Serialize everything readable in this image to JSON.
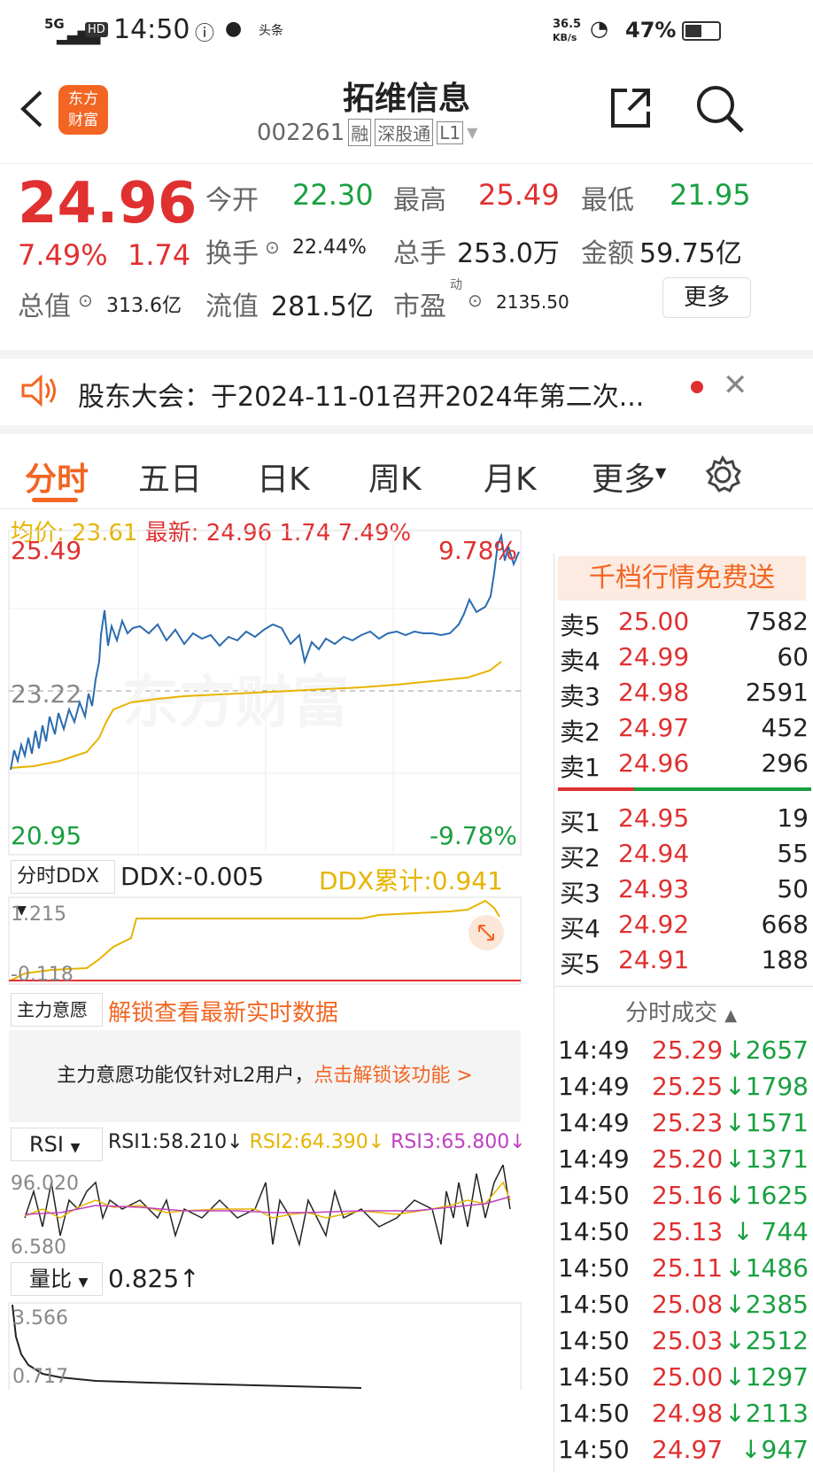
{
  "status": {
    "network": "5G",
    "time": "14:50",
    "speed": "36.5",
    "speed_unit": "KB/s",
    "battery": "47%",
    "app_badge": "头条"
  },
  "header": {
    "title": "拓维信息",
    "code": "002261",
    "badges": [
      "融",
      "深股通",
      "L1"
    ],
    "logo_line1": "东方",
    "logo_line2": "财富"
  },
  "quote": {
    "price": "24.96",
    "change_pct": "7.49%",
    "change": "1.74",
    "open_label": "今开",
    "open": "22.30",
    "high_label": "最高",
    "high": "25.49",
    "low_label": "最低",
    "low": "21.95",
    "turnover_label": "换手",
    "turnover": "22.44%",
    "volume_label": "总手",
    "volume": "253.0万",
    "amount_label": "金额",
    "amount": "59.75亿",
    "mktcap_label": "总值",
    "mktcap": "313.6亿",
    "float_label": "流值",
    "float": "281.5亿",
    "pe_label": "市盈",
    "pe_sup": "动",
    "pe": "2135.50",
    "more": "更多"
  },
  "notice": {
    "text": "股东大会：于2024-11-01召开2024年第二次..."
  },
  "tabs": [
    "分时",
    "五日",
    "日K",
    "周K",
    "月K",
    "更多"
  ],
  "avg": {
    "avg_label": "均价:",
    "avg": "23.61",
    "latest_label": "最新:",
    "latest": "24.96",
    "chg": "1.74",
    "pct": "7.49%"
  },
  "chart": {
    "ymax": "25.49",
    "ymid": "23.22",
    "ymin": "20.95",
    "pmax": "9.78%",
    "pmin": "-9.78%",
    "watermark": "东方财富"
  },
  "ddx": {
    "selector": "分时DDX",
    "ddx_label": "DDX:",
    "ddx": "-0.005",
    "cum_label": "DDX累计:",
    "cum": "0.941",
    "top": "1.215",
    "bottom": "-0.118"
  },
  "zhuli": {
    "selector": "主力意愿",
    "unlock": "解锁查看最新实时数据",
    "msg": "主力意愿功能仅针对L2用户，",
    "link": "点击解锁该功能 >"
  },
  "rsi": {
    "selector": "RSI",
    "rsi1": "RSI1:58.210↓",
    "rsi2": "RSI2:64.390↓",
    "rsi3": "RSI3:65.800↓",
    "top": "96.020",
    "bottom": "6.580"
  },
  "lb": {
    "selector": "量比",
    "value": "0.825↑",
    "top": "3.566",
    "bottom": "0.717"
  },
  "book": {
    "promo": "千档行情免费送",
    "asks": [
      {
        "label": "卖5",
        "price": "25.00",
        "vol": "7582"
      },
      {
        "label": "卖4",
        "price": "24.99",
        "vol": "60"
      },
      {
        "label": "卖3",
        "price": "24.98",
        "vol": "2591"
      },
      {
        "label": "卖2",
        "price": "24.97",
        "vol": "452"
      },
      {
        "label": "卖1",
        "price": "24.96",
        "vol": "296"
      }
    ],
    "bids": [
      {
        "label": "买1",
        "price": "24.95",
        "vol": "19"
      },
      {
        "label": "买2",
        "price": "24.94",
        "vol": "55"
      },
      {
        "label": "买3",
        "price": "24.93",
        "vol": "50"
      },
      {
        "label": "买4",
        "price": "24.92",
        "vol": "668"
      },
      {
        "label": "买5",
        "price": "24.91",
        "vol": "188"
      }
    ],
    "ticks_title": "分时成交",
    "ticks": [
      {
        "t": "14:49",
        "p": "25.29",
        "v": "↓2657"
      },
      {
        "t": "14:49",
        "p": "25.25",
        "v": "↓1798"
      },
      {
        "t": "14:49",
        "p": "25.23",
        "v": "↓1571"
      },
      {
        "t": "14:49",
        "p": "25.20",
        "v": "↓1371"
      },
      {
        "t": "14:50",
        "p": "25.16",
        "v": "↓1625"
      },
      {
        "t": "14:50",
        "p": "25.13",
        "v": "↓ 744"
      },
      {
        "t": "14:50",
        "p": "25.11",
        "v": "↓1486"
      },
      {
        "t": "14:50",
        "p": "25.08",
        "v": "↓2385"
      },
      {
        "t": "14:50",
        "p": "25.03",
        "v": "↓2512"
      },
      {
        "t": "14:50",
        "p": "25.00",
        "v": "↓1297"
      },
      {
        "t": "14:50",
        "p": "24.98",
        "v": "↓2113"
      },
      {
        "t": "14:50",
        "p": "24.97",
        "v": "↓947"
      }
    ]
  },
  "colors": {
    "up": "#e03030",
    "down": "#18a040",
    "line": "#2b6cb0",
    "avg": "#e6b400",
    "brand": "#f26522"
  }
}
